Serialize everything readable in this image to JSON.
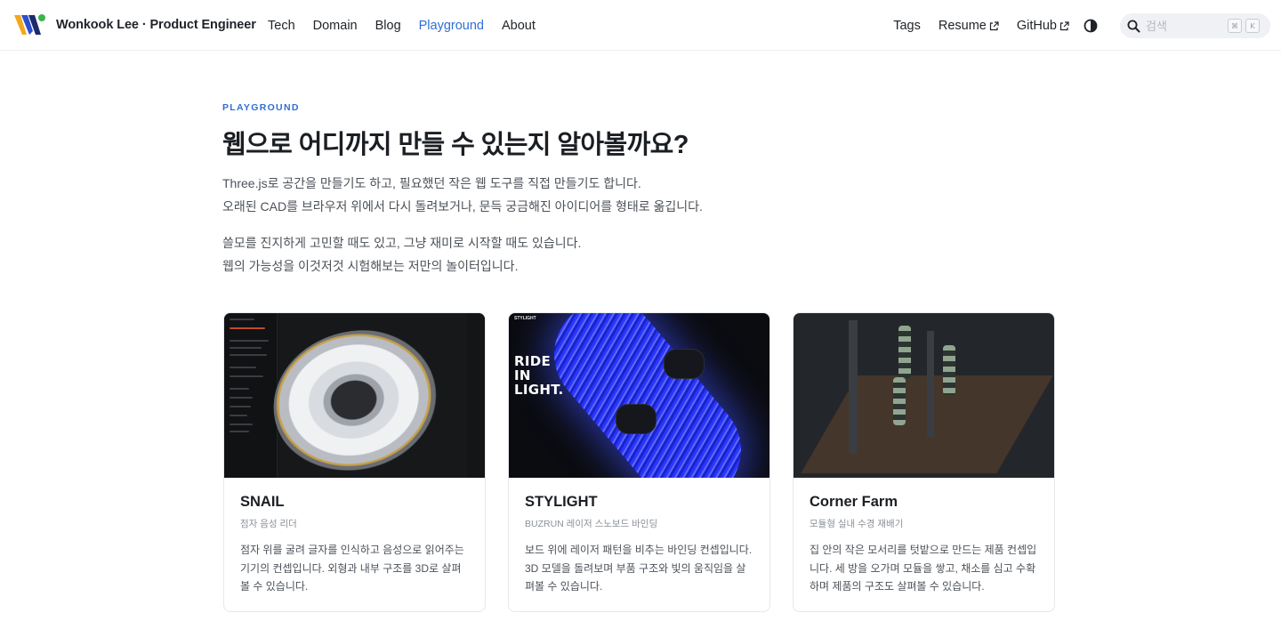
{
  "header": {
    "brand": "Wonkook Lee · Product Engineer",
    "nav": [
      {
        "label": "Tech",
        "active": false
      },
      {
        "label": "Domain",
        "active": false
      },
      {
        "label": "Blog",
        "active": false
      },
      {
        "label": "Playground",
        "active": true
      },
      {
        "label": "About",
        "active": false
      }
    ],
    "right_nav": {
      "tags": "Tags",
      "resume": "Resume",
      "github": "GitHub"
    },
    "search": {
      "placeholder": "검색",
      "shortcut_mod": "⌘",
      "shortcut_key": "K"
    }
  },
  "intro": {
    "eyebrow": "PLAYGROUND",
    "title": "웹으로 어디까지 만들 수 있는지 알아볼까요?",
    "lines": [
      "Three.js로 공간을 만들기도 하고, 필요했던 작은 웹 도구를 직접 만들기도 합니다.",
      "오래된 CAD를 브라우저 위에서 다시 돌려보거나, 문득 궁금해진 아이디어를 형태로 옮깁니다.",
      "쓸모를 진지하게 고민할 때도 있고, 그냥 재미로 시작할 때도 있습니다.",
      "웹의 가능성을 이것저것 시험해보는 저만의 놀이터입니다."
    ]
  },
  "projects": [
    {
      "title": "SNAIL",
      "subtitle": "점자 음성 리더",
      "description": "점자 위를 굴려 글자를 인식하고 음성으로 읽어주는 기기의 컨셉입니다. 외형과 내부 구조를 3D로 살펴볼 수 있습니다."
    },
    {
      "title": "STYLIGHT",
      "subtitle": "BUZRUN 레이저 스노보드 바인딩",
      "description": "보드 위에 레이저 패턴을 비추는 바인딩 컨셉입니다. 3D 모델을 돌려보며 부품 구조와 빛의 움직임을 살펴볼 수 있습니다.",
      "thumb_logo": "STYLIGHT",
      "thumb_text": "RIDE IN LIGHT."
    },
    {
      "title": "Corner Farm",
      "subtitle": "모듈형 실내 수경 재배기",
      "description": "집 안의 작은 모서리를 텃밭으로 만드는 제품 컨셉입니다. 세 방을 오가며 모듈을 쌓고, 채소를 심고 수확하며 제품의 구조도 살펴볼 수 있습니다."
    }
  ],
  "colors": {
    "accent": "#2f6fd3",
    "text": "#1f2328",
    "muted": "#4c5259"
  }
}
